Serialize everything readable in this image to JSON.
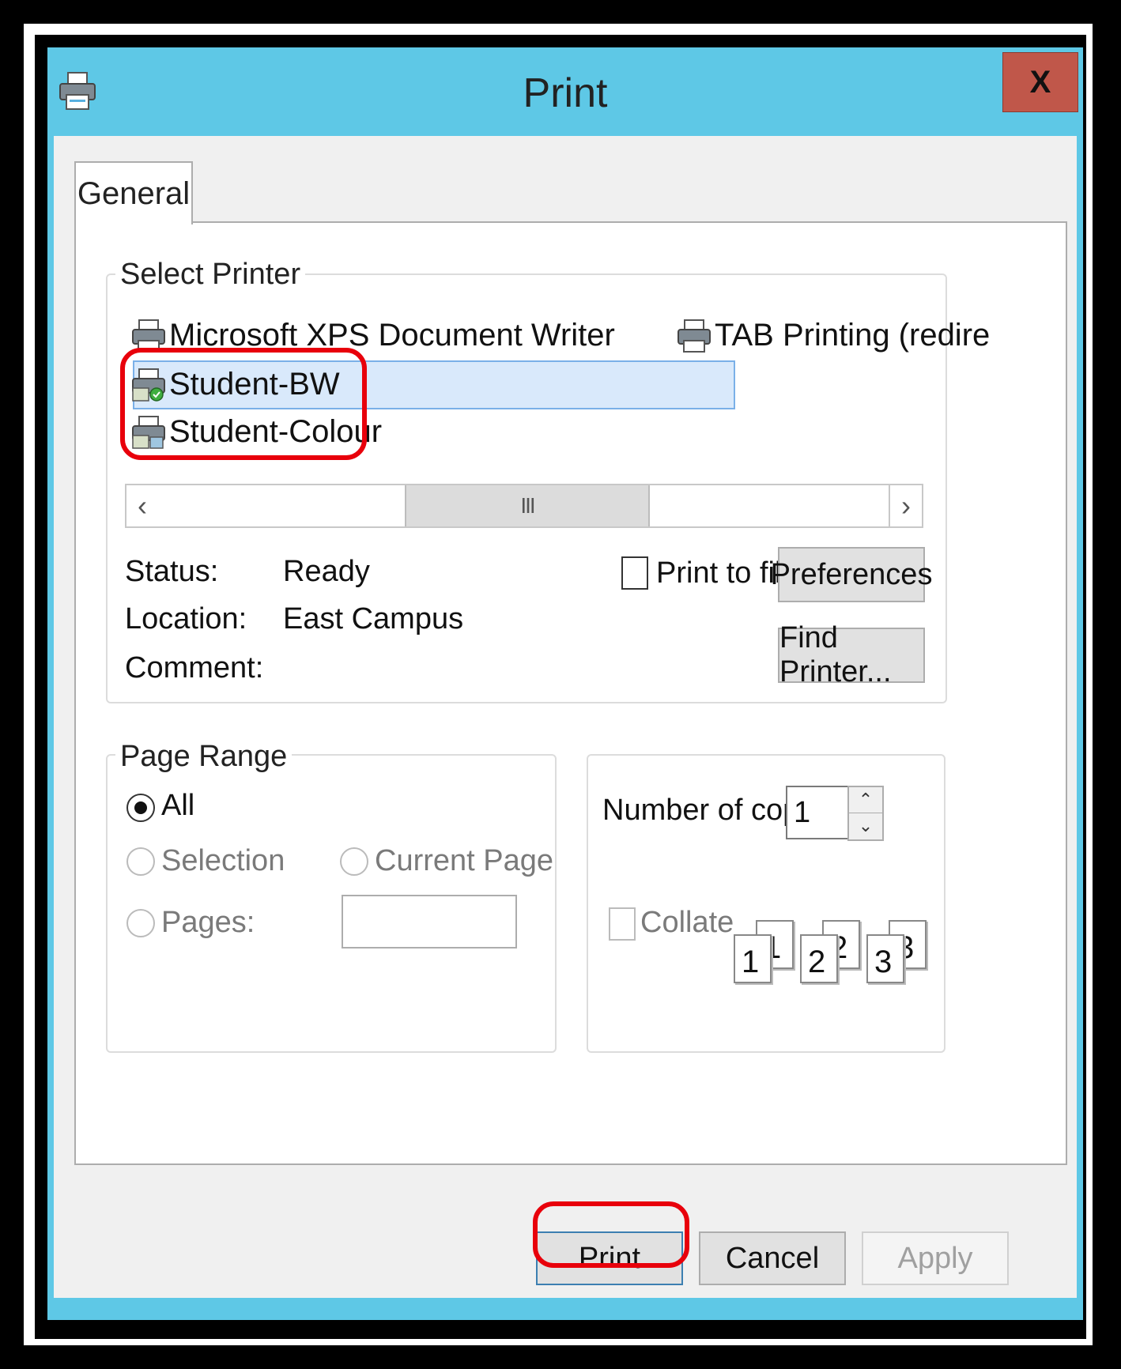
{
  "window": {
    "title": "Print",
    "close_label": "X"
  },
  "tabs": [
    {
      "label": "General"
    }
  ],
  "select_printer": {
    "group_label": "Select Printer",
    "printers": [
      {
        "name": "Microsoft XPS Document Writer",
        "icon": "printer-icon"
      },
      {
        "name": "TAB Printing (redire",
        "icon": "printer-icon"
      },
      {
        "name": "Student-BW",
        "icon": "network-printer-icon",
        "selected": true
      },
      {
        "name": "Student-Colour",
        "icon": "network-printer-icon"
      }
    ],
    "scroll_left": "‹",
    "scroll_right": "›",
    "scroll_thumb": "III"
  },
  "printer_info": {
    "status_label": "Status:",
    "status_value": "Ready",
    "location_label": "Location:",
    "location_value": "East Campus",
    "comment_label": "Comment:",
    "comment_value": ""
  },
  "options": {
    "print_to_file_label": "Print to file",
    "print_to_file_checked": false,
    "preferences_label": "Preferences",
    "find_printer_label": "Find Printer..."
  },
  "page_range": {
    "group_label": "Page Range",
    "all_label": "All",
    "selection_label": "Selection",
    "current_page_label": "Current Page",
    "pages_label": "Pages:",
    "pages_value": "",
    "selected": "All"
  },
  "copies": {
    "label": "Number of copies:",
    "value": "1",
    "collate_label": "Collate",
    "collate_checked": false,
    "collate_pages": [
      "1",
      "1",
      "2",
      "2",
      "3",
      "3"
    ]
  },
  "buttons": {
    "print": "Print",
    "cancel": "Cancel",
    "apply": "Apply"
  },
  "colors": {
    "titlebar": "#5ec8e6",
    "close_button": "#c0574a",
    "highlight_annotation": "#e8000b",
    "selection": "#d9e9fb"
  }
}
